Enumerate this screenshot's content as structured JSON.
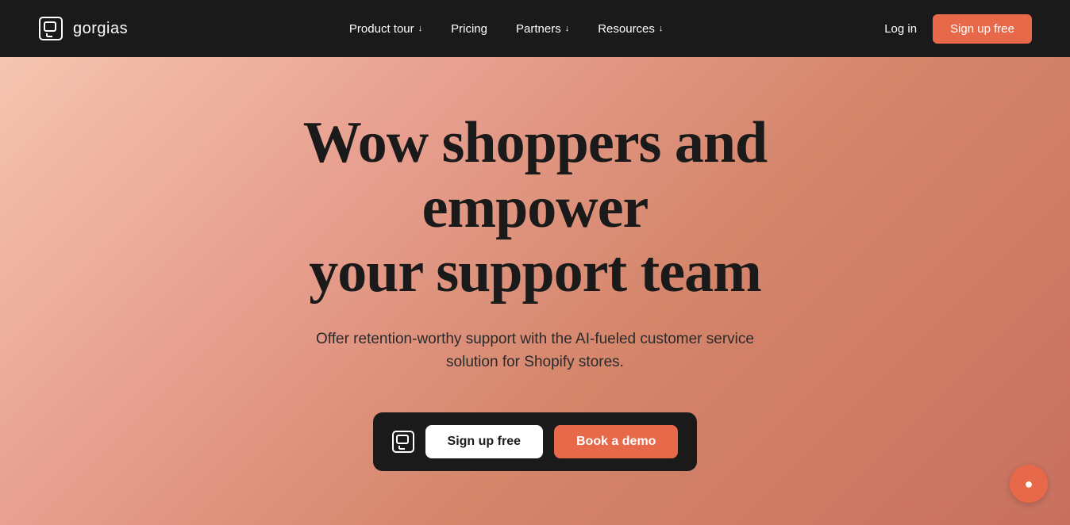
{
  "brand": {
    "name": "gorgias",
    "logo_alt": "Gorgias logo"
  },
  "navbar": {
    "nav_items": [
      {
        "label": "Product tour",
        "has_dropdown": true
      },
      {
        "label": "Pricing",
        "has_dropdown": false
      },
      {
        "label": "Partners",
        "has_dropdown": true
      },
      {
        "label": "Resources",
        "has_dropdown": true
      }
    ],
    "login_label": "Log in",
    "signup_label": "Sign up free"
  },
  "hero": {
    "title_line1": "Wow shoppers and empower",
    "title_line2": "your support team",
    "subtitle": "Offer retention-worthy support with the AI-fueled customer service solution for Shopify stores.",
    "cta_signup": "Sign up free",
    "cta_demo": "Book a demo"
  },
  "chat": {
    "icon": "💬"
  },
  "colors": {
    "nav_bg": "#1a1a1a",
    "signup_btn_color": "#e8684a",
    "hero_bg_start": "#f5c5b0",
    "hero_bg_end": "#c87060",
    "cta_container_bg": "#1a1a1a"
  }
}
